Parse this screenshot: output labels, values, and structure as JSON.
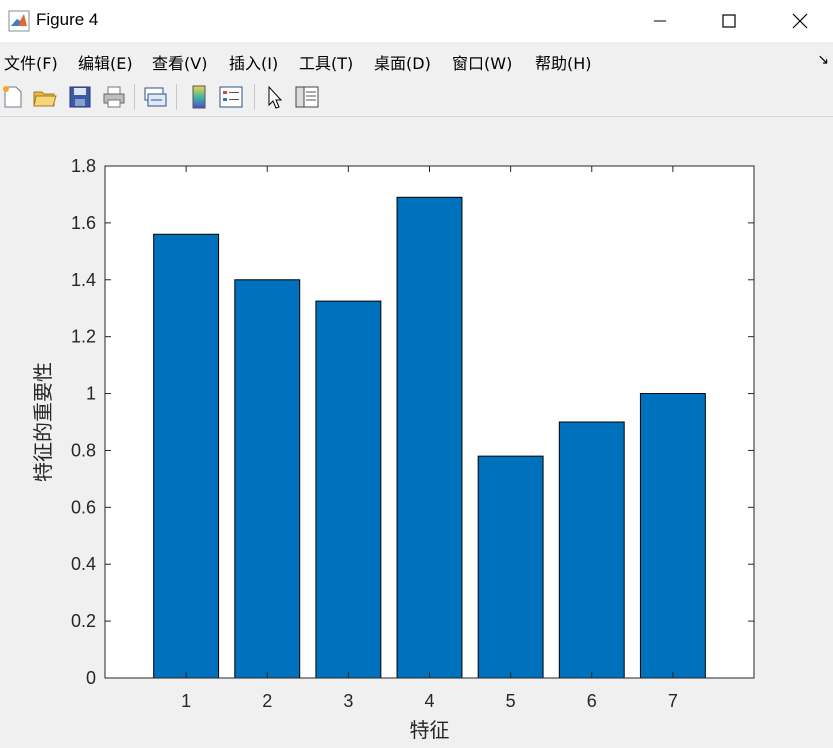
{
  "window": {
    "title": "Figure 4",
    "controls": {
      "minimize": "—",
      "maximize": "☐",
      "close": "✕"
    }
  },
  "menu": {
    "items": [
      {
        "label": "文件(F)"
      },
      {
        "label": "编辑(E)"
      },
      {
        "label": "查看(V)"
      },
      {
        "label": "插入(I)"
      },
      {
        "label": "工具(T)"
      },
      {
        "label": "桌面(D)"
      },
      {
        "label": "窗口(W)"
      },
      {
        "label": "帮助(H)"
      }
    ],
    "overflow_arrow": "↘"
  },
  "toolbar": {
    "buttons": [
      {
        "icon": "new-figure-icon"
      },
      {
        "icon": "open-file-icon"
      },
      {
        "icon": "save-icon"
      },
      {
        "icon": "print-icon"
      },
      {
        "icon": "link-plot-icon"
      },
      {
        "icon": "colorbar-icon"
      },
      {
        "icon": "legend-icon"
      },
      {
        "icon": "pointer-icon"
      },
      {
        "icon": "property-inspector-icon"
      }
    ]
  },
  "chart_data": {
    "type": "bar",
    "categories": [
      "1",
      "2",
      "3",
      "4",
      "5",
      "6",
      "7"
    ],
    "values": [
      1.56,
      1.4,
      1.325,
      1.69,
      0.78,
      0.9,
      1.0
    ],
    "xlabel": "特征",
    "ylabel": "特征的重要性",
    "ylim": [
      0,
      1.8
    ],
    "yticks": [
      "0",
      "0.2",
      "0.4",
      "0.6",
      "0.8",
      "1",
      "1.2",
      "1.4",
      "1.6",
      "1.8"
    ],
    "xlim": [
      0,
      8
    ],
    "bar_color": "#0072bd",
    "grid": false
  }
}
